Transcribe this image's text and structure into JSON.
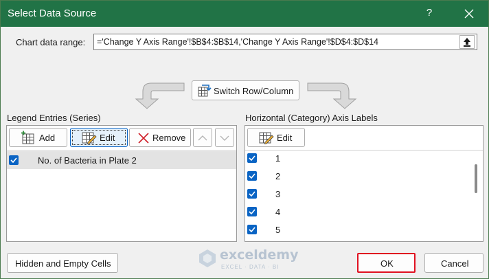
{
  "window": {
    "title": "Select Data Source",
    "help_glyph": "?"
  },
  "range": {
    "label": "Chart data range:",
    "value": "='Change Y Axis Range'!$B$4:$B$14,'Change Y Axis Range'!$D$4:$D$14"
  },
  "switch_button": "Switch Row/Column",
  "legend": {
    "title": "Legend Entries (Series)",
    "add_label": "Add",
    "edit_label": "Edit",
    "remove_label": "Remove",
    "items": [
      {
        "label": "No. of Bacteria in Plate 2",
        "checked": true,
        "selected": true
      }
    ]
  },
  "axis": {
    "title": "Horizontal (Category) Axis Labels",
    "edit_label": "Edit",
    "items": [
      {
        "label": "1",
        "checked": true
      },
      {
        "label": "2",
        "checked": true
      },
      {
        "label": "3",
        "checked": true
      },
      {
        "label": "4",
        "checked": true
      },
      {
        "label": "5",
        "checked": true
      }
    ]
  },
  "footer": {
    "hidden_label": "Hidden and Empty Cells",
    "ok_label": "OK",
    "cancel_label": "Cancel"
  },
  "watermark": {
    "brand": "exceldemy",
    "tagline": "EXCEL · DATA · BI"
  },
  "colors": {
    "titlebar": "#217346",
    "checkbox": "#0a64c4",
    "ok_highlight": "#e01020",
    "remove_icon": "#d0202a"
  }
}
